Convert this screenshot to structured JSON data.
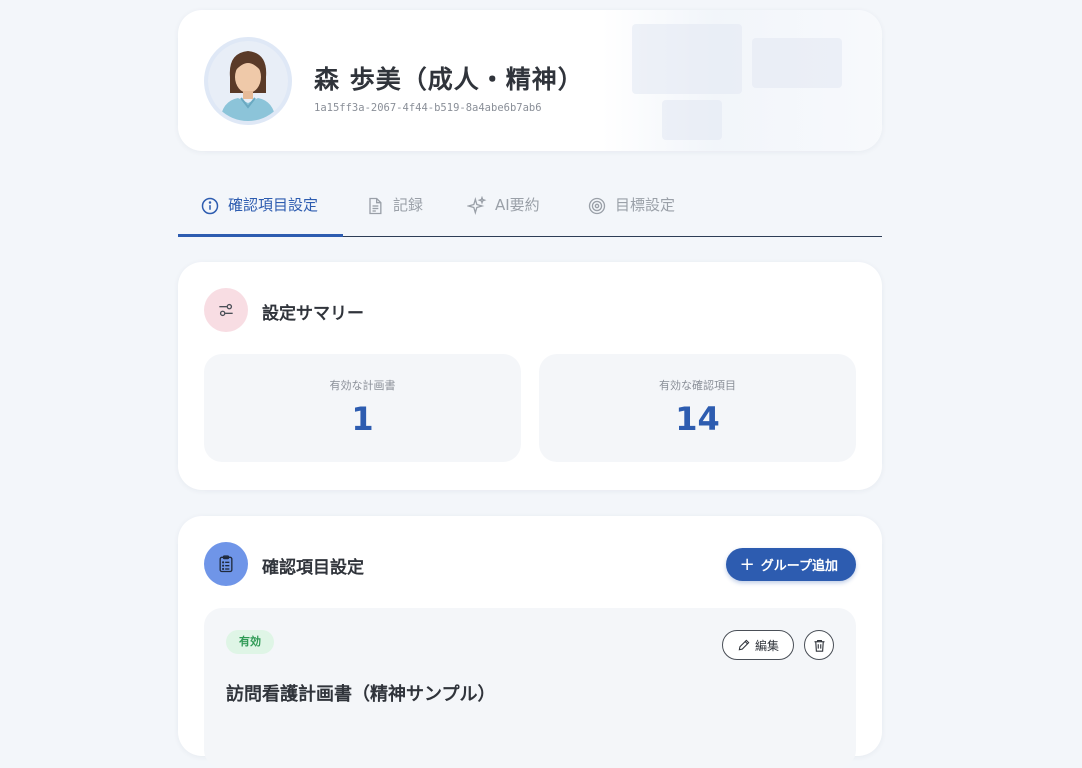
{
  "profile": {
    "name": "森 歩美（成人・精神）",
    "id": "1a15ff3a-2067-4f44-b519-8a4abe6b7ab6",
    "avatar_icon": "user-photo"
  },
  "tabs": [
    {
      "label": "確認項目設定",
      "icon": "info-icon",
      "active": true
    },
    {
      "label": "記録",
      "icon": "document-icon",
      "active": false
    },
    {
      "label": "AI要約",
      "icon": "sparkles-icon",
      "active": false
    },
    {
      "label": "目標設定",
      "icon": "target-icon",
      "active": false
    }
  ],
  "summary": {
    "title": "設定サマリー",
    "icon": "sliders-icon",
    "stats": [
      {
        "label": "有効な計画書",
        "value": "1"
      },
      {
        "label": "有効な確認項目",
        "value": "14"
      }
    ]
  },
  "check_items": {
    "title": "確認項目設定",
    "icon": "clipboard-list-icon",
    "add_button": "グループ追加",
    "plans": [
      {
        "status": "有効",
        "edit_label": "編集",
        "title": "訪問看護計画書（精神サンプル）"
      }
    ]
  },
  "colors": {
    "accent": "#2d5cb0",
    "background": "#f3f6fa",
    "summary_icon_bg": "#f8dde3",
    "items_icon_bg": "#6f95e8",
    "badge_bg": "#dff5e6",
    "badge_text": "#2f9a55"
  }
}
